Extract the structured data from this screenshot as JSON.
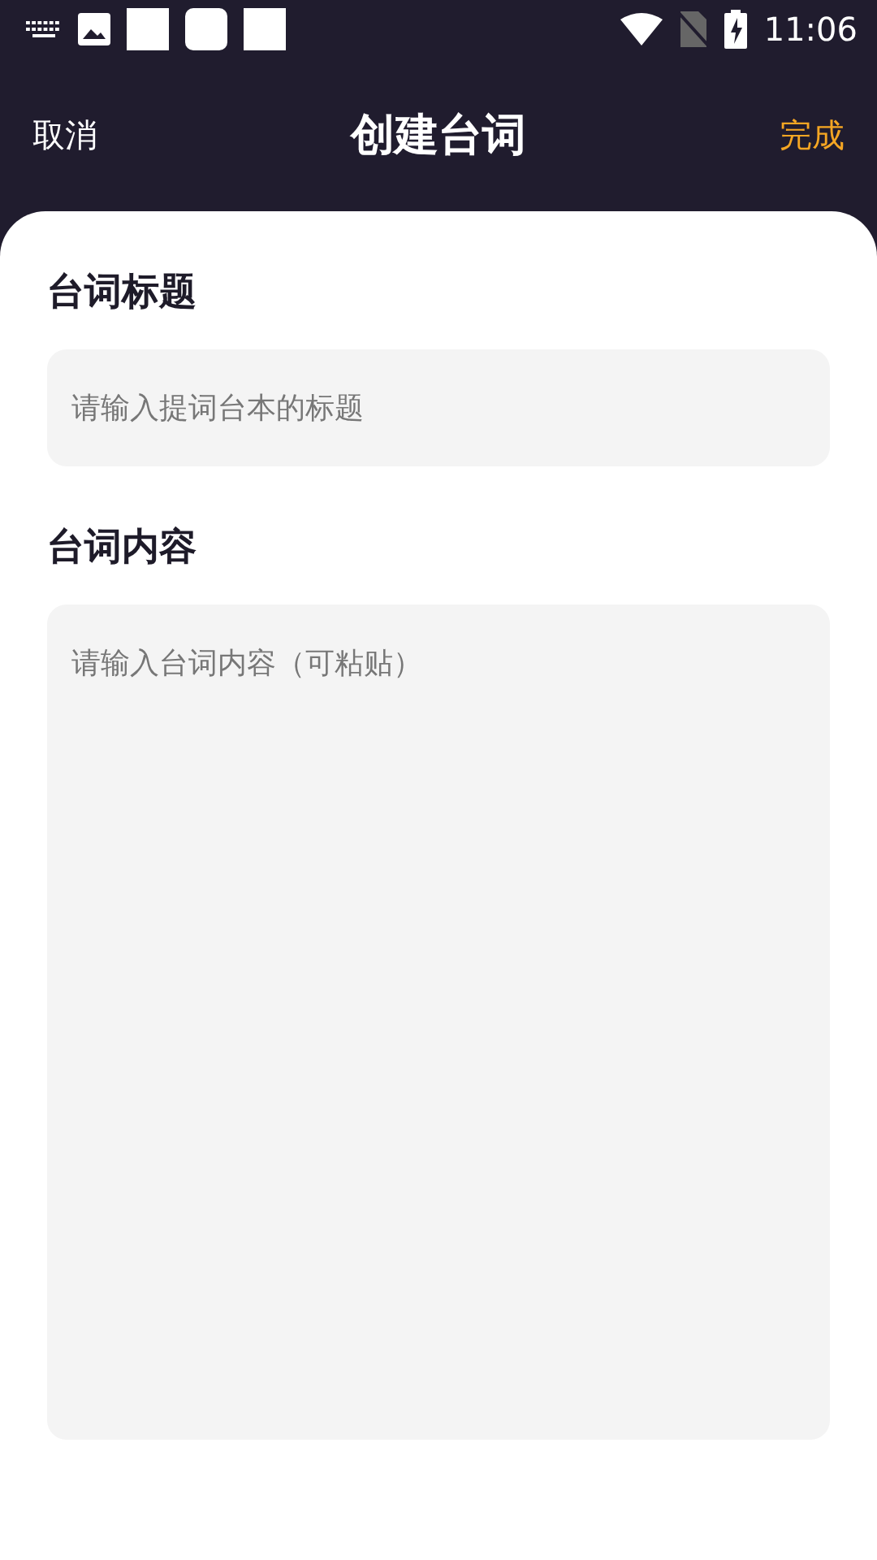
{
  "status_bar": {
    "time": "11:06"
  },
  "nav": {
    "cancel": "取消",
    "title": "创建台词",
    "done": "完成"
  },
  "fields": [
    {
      "label": "台词标题",
      "placeholder": "请输入提词台本的标题",
      "kind": "line"
    },
    {
      "label": "台词内容",
      "placeholder": "请输入台词内容（可粘贴）",
      "kind": "area"
    }
  ]
}
